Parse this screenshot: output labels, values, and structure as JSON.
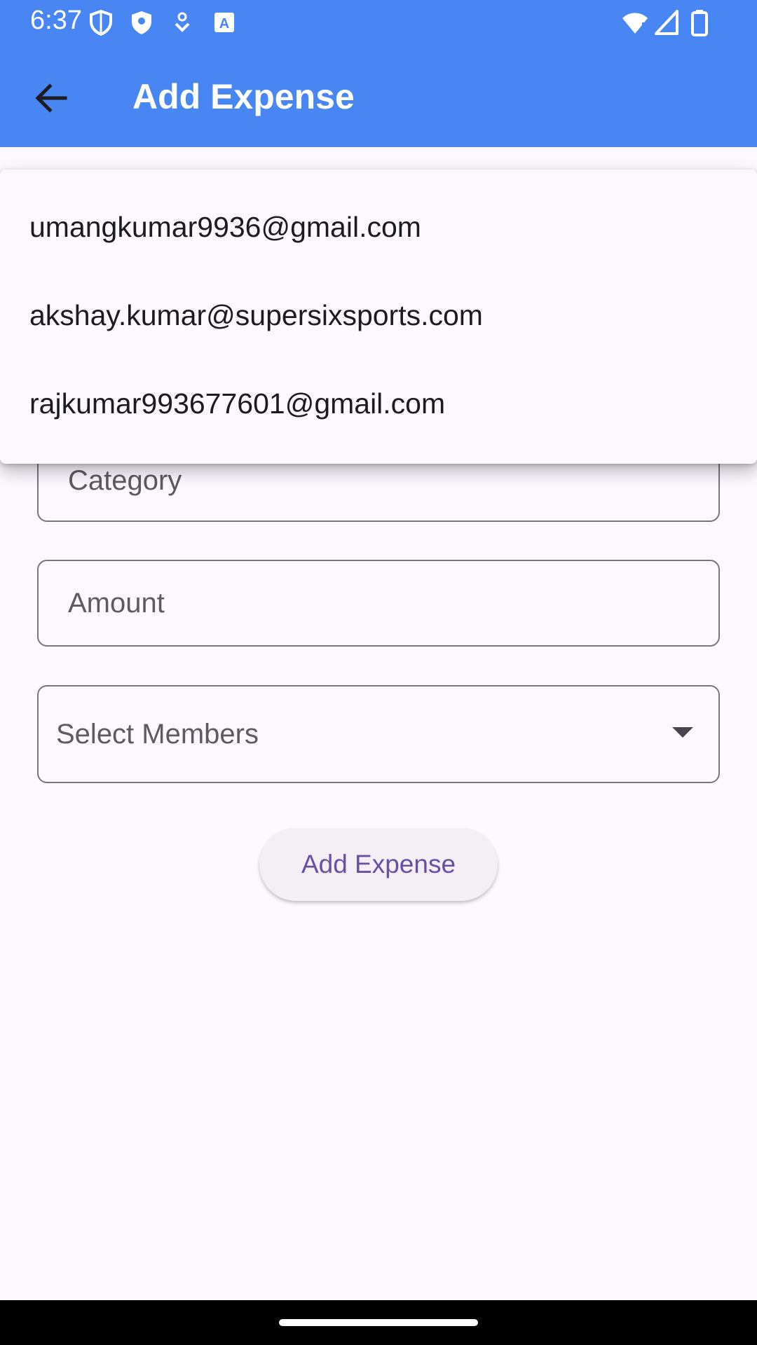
{
  "status_bar": {
    "time": "6:37",
    "left_icons": [
      "shield-outline-icon",
      "shield-filled-icon",
      "download-icon",
      "keyboard-a-icon"
    ],
    "right_icons": [
      "wifi-icon",
      "signal-icon",
      "battery-icon"
    ]
  },
  "app_bar": {
    "title": "Add Expense",
    "background_color": "#4786F3"
  },
  "form": {
    "category_label": "Category",
    "amount_label": "Amount",
    "members_label": "Select Members",
    "submit_label": "Add Expense"
  },
  "members_menu": {
    "items": [
      {
        "label": "umangkumar9936@gmail.com"
      },
      {
        "label": "akshay.kumar@supersixsports.com"
      },
      {
        "label": "rajkumar993677601@gmail.com"
      }
    ]
  },
  "colors": {
    "accent": "#6750A4",
    "surface": "#FDF7FE"
  }
}
